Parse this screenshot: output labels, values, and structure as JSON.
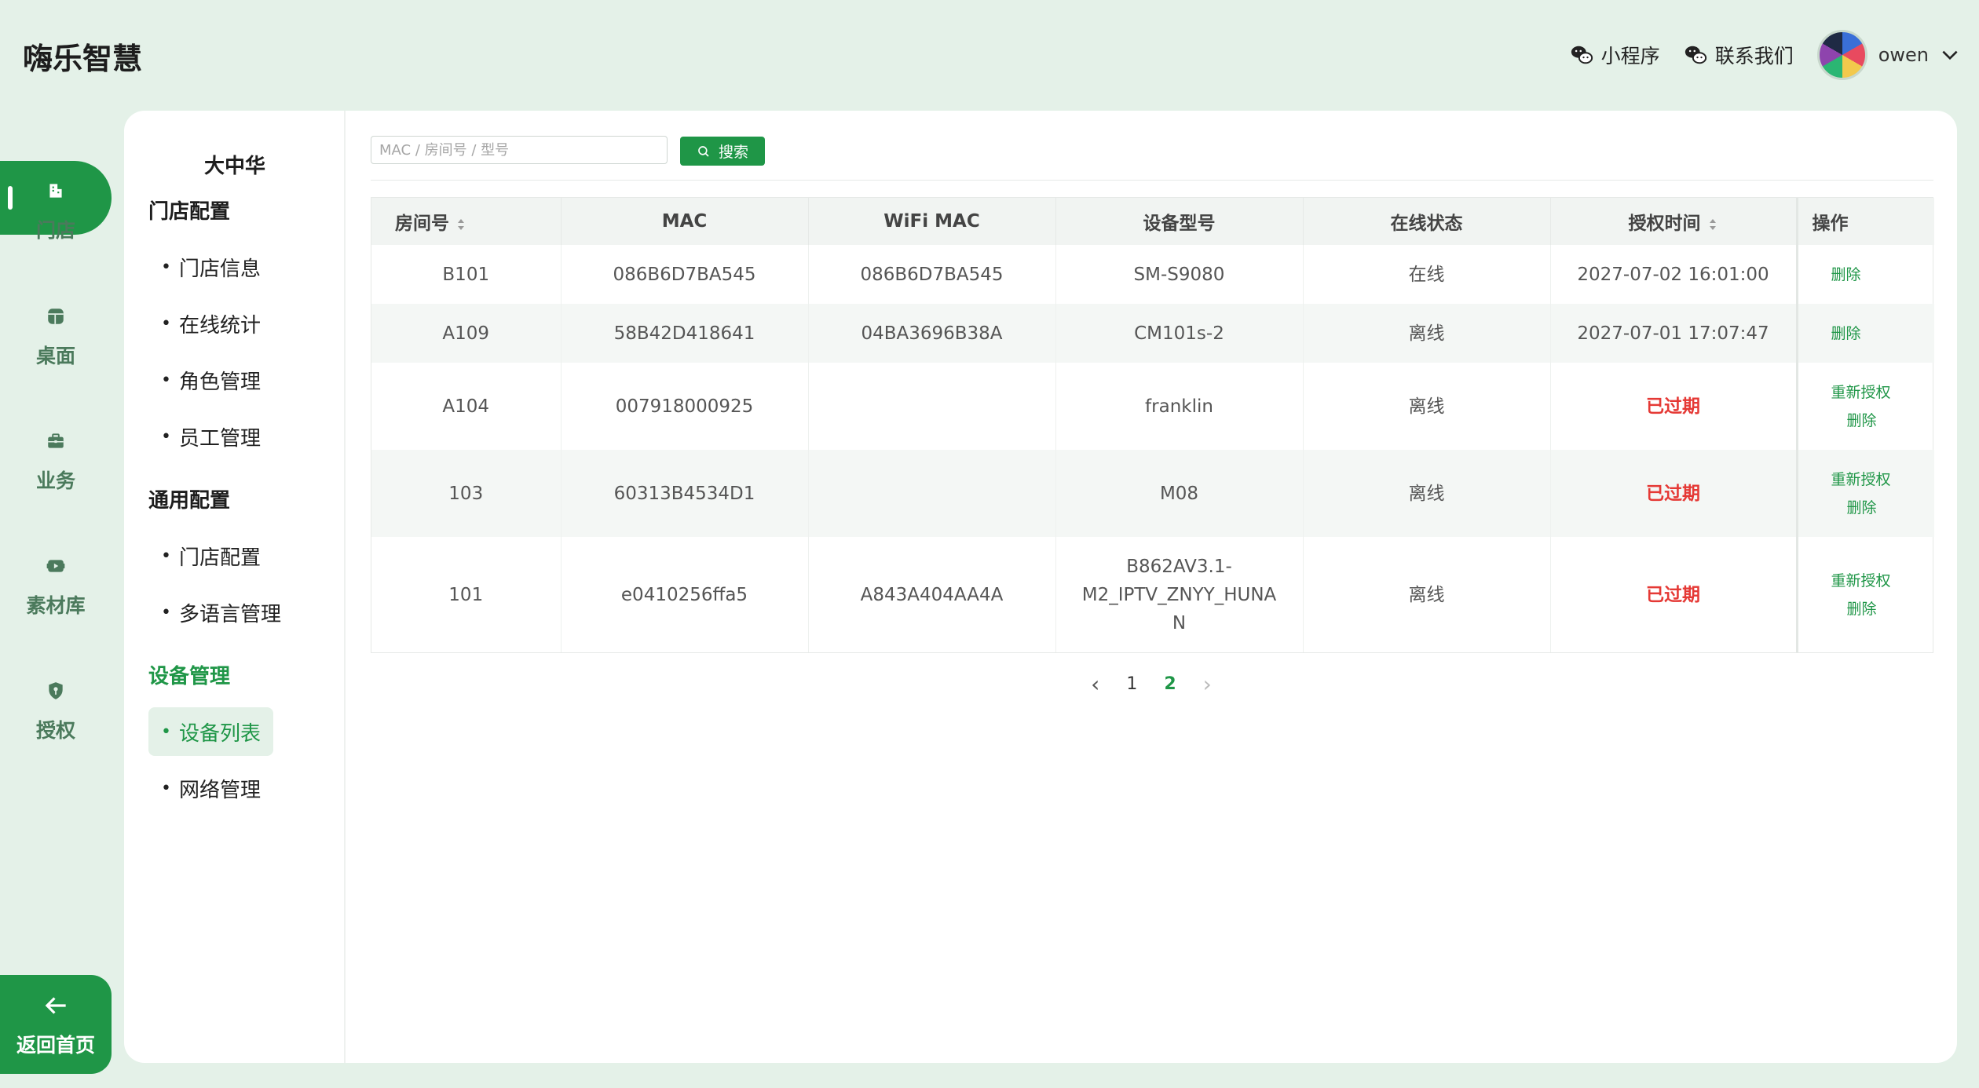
{
  "header": {
    "app_title": "嗨乐智慧",
    "mini_program": "小程序",
    "contact_us": "联系我们",
    "username": "owen"
  },
  "rail": {
    "items": [
      {
        "label": "门店",
        "icon": "store-icon"
      },
      {
        "label": "桌面",
        "icon": "desktop-icon"
      },
      {
        "label": "业务",
        "icon": "briefcase-icon"
      },
      {
        "label": "素材库",
        "icon": "media-icon"
      },
      {
        "label": "授权",
        "icon": "shield-key-icon"
      }
    ],
    "back_home": "返回首页"
  },
  "submenu": {
    "store_name": "大中华",
    "groups": [
      {
        "title": "门店配置",
        "items": [
          "门店信息",
          "在线统计",
          "角色管理",
          "员工管理"
        ]
      },
      {
        "title": "通用配置",
        "items": [
          "门店配置",
          "多语言管理"
        ]
      },
      {
        "title": "设备管理",
        "items": [
          "设备列表",
          "网络管理"
        ]
      }
    ],
    "bullet": "•"
  },
  "search": {
    "placeholder": "MAC / 房间号 / 型号",
    "button": "搜索"
  },
  "table": {
    "columns": [
      "房间号",
      "MAC",
      "WiFi MAC",
      "设备型号",
      "在线状态",
      "授权时间",
      "操作"
    ],
    "rows": [
      {
        "room": "B101",
        "mac": "086B6D7BA545",
        "wifi_mac": "086B6D7BA545",
        "model": "SM-S9080",
        "status": "在线",
        "auth_time": "2027-07-02 16:01:00",
        "ops": [
          "删除"
        ]
      },
      {
        "room": "A109",
        "mac": "58B42D418641",
        "wifi_mac": "04BA3696B38A",
        "model": "CM101s-2",
        "status": "离线",
        "auth_time": "2027-07-01 17:07:47",
        "ops": [
          "删除"
        ]
      },
      {
        "room": "A104",
        "mac": "007918000925",
        "wifi_mac": "",
        "model": "franklin",
        "status": "离线",
        "auth_time": "已过期",
        "ops": [
          "重新授权",
          "删除"
        ]
      },
      {
        "room": "103",
        "mac": "60313B4534D1",
        "wifi_mac": "",
        "model": "M08",
        "status": "离线",
        "auth_time": "已过期",
        "ops": [
          "重新授权",
          "删除"
        ]
      },
      {
        "room": "101",
        "mac": "e0410256ffa5",
        "wifi_mac": "A843A404AA4A",
        "model": "B862AV3.1-\nM2_IPTV_ZNYY_HUNA\nN",
        "status": "离线",
        "auth_time": "已过期",
        "ops": [
          "重新授权",
          "删除"
        ]
      }
    ]
  },
  "pagination": {
    "prev": "‹",
    "pages": [
      "1",
      "2"
    ],
    "current": "2",
    "next": "›"
  },
  "colors": {
    "brand": "#1f9647",
    "background": "#e4f1e8",
    "expired": "#e53935"
  }
}
